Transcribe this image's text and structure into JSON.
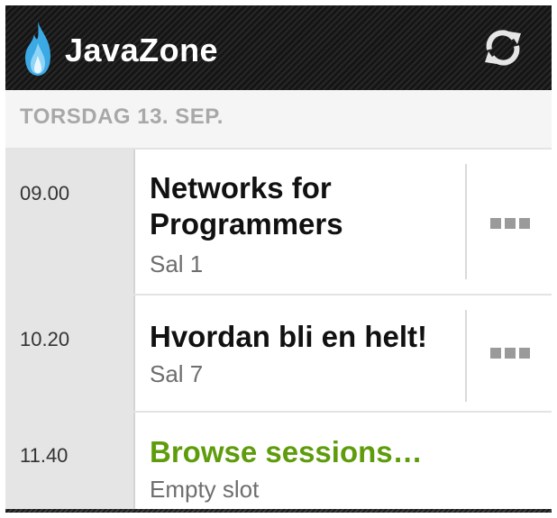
{
  "app": {
    "title": "JavaZone",
    "logo_icon": "flame-logo-icon",
    "refresh_icon": "refresh-icon"
  },
  "section": {
    "title": "TORSDAG 13. SEP."
  },
  "colors": {
    "actionbar": "#1c1c1c",
    "time_column": "#e5e5e5",
    "accent_green": "#5f9c0c",
    "flame_blue": "#3aa9e4"
  },
  "sessions": [
    {
      "time": "09.00",
      "title": "Networks for Programmers",
      "room": "Sal 1",
      "menu_icon": "overflow-menu-icon"
    },
    {
      "time": "10.20",
      "title": "Hvordan bli en helt!",
      "room": "Sal 7",
      "menu_icon": "overflow-menu-icon"
    },
    {
      "time": "11.40",
      "title": "Browse sessions…",
      "room": "Empty slot"
    }
  ]
}
